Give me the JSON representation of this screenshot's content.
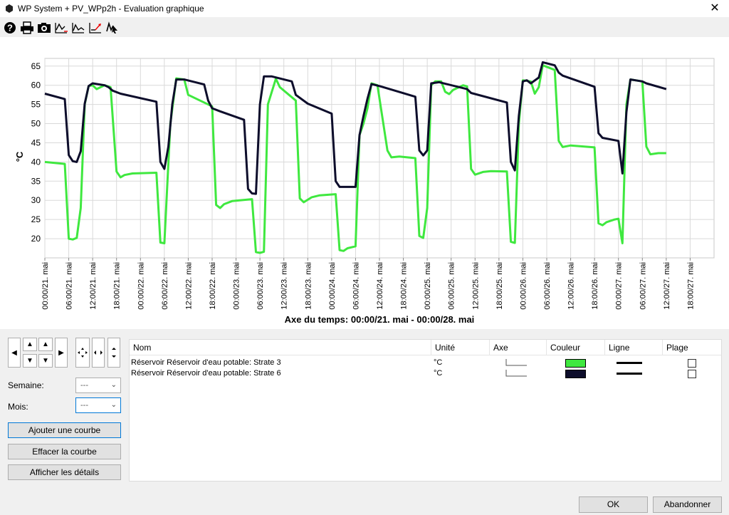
{
  "window": {
    "title": "WP System + PV_WPp2h - Evaluation graphique"
  },
  "toolbar": {
    "icons": [
      "help-icon",
      "print-icon",
      "camera-icon",
      "curve-add-icon",
      "curve-edit-icon",
      "curve-compare-icon",
      "cursor-icon"
    ]
  },
  "chart_data": {
    "type": "line",
    "ylabel": "°C",
    "xlabel": "Axe du temps: 00:00/21. mai - 00:00/28. mai",
    "ylim": [
      15,
      67
    ],
    "yticks": [
      20,
      25,
      30,
      35,
      40,
      45,
      50,
      55,
      60,
      65
    ],
    "xlim": [
      0,
      168
    ],
    "xticks": [
      "00:00/21. mai",
      "06:00/21. mai",
      "12:00/21. mai",
      "18:00/21. mai",
      "00:00/22. mai",
      "06:00/22. mai",
      "12:00/22. mai",
      "18:00/22. mai",
      "00:00/23. mai",
      "06:00/23. mai",
      "12:00/23. mai",
      "18:00/23. mai",
      "00:00/24. mai",
      "06:00/24. mai",
      "12:00/24. mai",
      "18:00/24. mai",
      "00:00/25. mai",
      "06:00/25. mai",
      "12:00/25. mai",
      "18:00/25. mai",
      "00:00/26. mai",
      "06:00/26. mai",
      "12:00/26. mai",
      "18:00/26. mai",
      "00:00/27. mai",
      "06:00/27. mai",
      "12:00/27. mai",
      "18:00/27. mai"
    ],
    "grid": true,
    "series": [
      {
        "name": "Réservoir Réservoir d'eau potable: Strate 3",
        "color": "#3fe83f",
        "points": [
          [
            0,
            40
          ],
          [
            5,
            39.5
          ],
          [
            6,
            20
          ],
          [
            7,
            19.8
          ],
          [
            8,
            20.2
          ],
          [
            9,
            28
          ],
          [
            10,
            55
          ],
          [
            11,
            59.8
          ],
          [
            12,
            60
          ],
          [
            13,
            59
          ],
          [
            14,
            59.5
          ],
          [
            15,
            60
          ],
          [
            16.5,
            59.5
          ],
          [
            18,
            37.5
          ],
          [
            19,
            36
          ],
          [
            20,
            36.6
          ],
          [
            22,
            37
          ],
          [
            28,
            37.2
          ],
          [
            29,
            19
          ],
          [
            30,
            18.8
          ],
          [
            31.5,
            50
          ],
          [
            33,
            61.8
          ],
          [
            35,
            61.5
          ],
          [
            36,
            57.5
          ],
          [
            42,
            54.5
          ],
          [
            43,
            28.8
          ],
          [
            44,
            28
          ],
          [
            45,
            29
          ],
          [
            47,
            29.8
          ],
          [
            52,
            30.3
          ],
          [
            53,
            16.5
          ],
          [
            54,
            16.3
          ],
          [
            55,
            16.6
          ],
          [
            56,
            55
          ],
          [
            58,
            61.7
          ],
          [
            59,
            59.5
          ],
          [
            63,
            56
          ],
          [
            64,
            30.5
          ],
          [
            65,
            29.5
          ],
          [
            67,
            30.8
          ],
          [
            69,
            31.3
          ],
          [
            73,
            31.6
          ],
          [
            74,
            17
          ],
          [
            75,
            16.8
          ],
          [
            76,
            17.5
          ],
          [
            78,
            18
          ],
          [
            79,
            47
          ],
          [
            80,
            50
          ],
          [
            81,
            54
          ],
          [
            82,
            60.5
          ],
          [
            83.5,
            60
          ],
          [
            86,
            43
          ],
          [
            87,
            41.2
          ],
          [
            89,
            41.4
          ],
          [
            93,
            41
          ],
          [
            94,
            20.7
          ],
          [
            95,
            20.2
          ],
          [
            96,
            28
          ],
          [
            97,
            60
          ],
          [
            98,
            61
          ],
          [
            99.5,
            61
          ],
          [
            100.5,
            58.3
          ],
          [
            101.5,
            57.7
          ],
          [
            102.5,
            58.8
          ],
          [
            104,
            59.5
          ],
          [
            105,
            60
          ],
          [
            106,
            59.7
          ],
          [
            107,
            38.2
          ],
          [
            108,
            36.7
          ],
          [
            110,
            37.4
          ],
          [
            112,
            37.6
          ],
          [
            116,
            37.5
          ],
          [
            117,
            19.2
          ],
          [
            118,
            18.9
          ],
          [
            119,
            50
          ],
          [
            120,
            61.3
          ],
          [
            122,
            61
          ],
          [
            123,
            57.8
          ],
          [
            124,
            59.5
          ],
          [
            125,
            65.2
          ],
          [
            128,
            64
          ],
          [
            129,
            45.5
          ],
          [
            130,
            43.9
          ],
          [
            132,
            44.3
          ],
          [
            138,
            43.8
          ],
          [
            139,
            24
          ],
          [
            140,
            23.5
          ],
          [
            141,
            24.3
          ],
          [
            143,
            25
          ],
          [
            144,
            25.2
          ],
          [
            145,
            18.8
          ],
          [
            146,
            55
          ],
          [
            147,
            61.5
          ],
          [
            150,
            61
          ],
          [
            151,
            44
          ],
          [
            152,
            42
          ],
          [
            154,
            42.3
          ],
          [
            156,
            42.3
          ]
        ]
      },
      {
        "name": "Réservoir Réservoir d'eau potable: Strate 6",
        "color": "#0d0d2b",
        "points": [
          [
            0,
            57.8
          ],
          [
            5,
            56.4
          ],
          [
            6,
            41.8
          ],
          [
            7,
            40.2
          ],
          [
            8,
            40
          ],
          [
            9,
            42.8
          ],
          [
            10,
            55.2
          ],
          [
            11,
            59.8
          ],
          [
            12,
            60.5
          ],
          [
            15,
            60
          ],
          [
            16,
            59.5
          ],
          [
            17,
            58.6
          ],
          [
            19,
            57.8
          ],
          [
            28,
            55.7
          ],
          [
            29,
            40
          ],
          [
            30,
            38.2
          ],
          [
            31,
            44
          ],
          [
            32,
            55
          ],
          [
            33,
            61.5
          ],
          [
            35,
            61.5
          ],
          [
            40,
            60.2
          ],
          [
            41,
            56
          ],
          [
            42,
            54
          ],
          [
            44,
            53.2
          ],
          [
            50,
            51
          ],
          [
            51,
            33
          ],
          [
            52,
            31.8
          ],
          [
            53,
            31.7
          ],
          [
            54,
            55
          ],
          [
            55,
            62.3
          ],
          [
            57,
            62.3
          ],
          [
            62,
            61
          ],
          [
            63,
            57.5
          ],
          [
            66,
            55.2
          ],
          [
            72,
            52.6
          ],
          [
            73,
            35
          ],
          [
            74,
            33.5
          ],
          [
            78,
            33.5
          ],
          [
            79,
            47
          ],
          [
            80,
            52
          ],
          [
            81,
            56.5
          ],
          [
            82,
            60.3
          ],
          [
            84,
            59.8
          ],
          [
            85,
            59.5
          ],
          [
            93,
            57
          ],
          [
            94,
            43
          ],
          [
            95,
            41.7
          ],
          [
            96,
            43
          ],
          [
            97,
            60.5
          ],
          [
            99,
            60.8
          ],
          [
            106,
            59
          ],
          [
            107,
            58
          ],
          [
            116,
            55.5
          ],
          [
            117,
            40
          ],
          [
            118,
            37.8
          ],
          [
            119,
            52
          ],
          [
            120,
            61
          ],
          [
            121,
            61.3
          ],
          [
            122,
            60.5
          ],
          [
            124,
            62
          ],
          [
            125,
            66
          ],
          [
            128,
            65.2
          ],
          [
            129,
            63.3
          ],
          [
            130,
            62.5
          ],
          [
            138,
            59.6
          ],
          [
            139,
            47.5
          ],
          [
            140,
            46.3
          ],
          [
            144,
            45.5
          ],
          [
            145,
            37
          ],
          [
            146,
            53
          ],
          [
            147,
            61.5
          ],
          [
            150,
            61
          ],
          [
            151,
            60.5
          ],
          [
            156,
            59
          ]
        ]
      }
    ]
  },
  "nav": {
    "left": "◀",
    "right": "▶",
    "up": "▲",
    "down": "▼"
  },
  "selectors": {
    "semaine_label": "Semaine:",
    "semaine_value": "---",
    "mois_label": "Mois:",
    "mois_value": "---"
  },
  "actions": {
    "add_curve": "Ajouter une courbe",
    "clear_curve": "Effacer la courbe",
    "show_details": "Afficher les détails"
  },
  "list": {
    "headers": [
      "Nom",
      "Unité",
      "Axe",
      "Couleur",
      "Ligne",
      "Plage"
    ],
    "rows": [
      {
        "name": "Réservoir  Réservoir d'eau potable: Strate 3",
        "unit": "°C",
        "color": "#3fe83f"
      },
      {
        "name": "Réservoir  Réservoir d'eau potable: Strate 6",
        "unit": "°C",
        "color": "#0d0d2b"
      }
    ]
  },
  "footer": {
    "ok": "OK",
    "cancel": "Abandonner"
  }
}
